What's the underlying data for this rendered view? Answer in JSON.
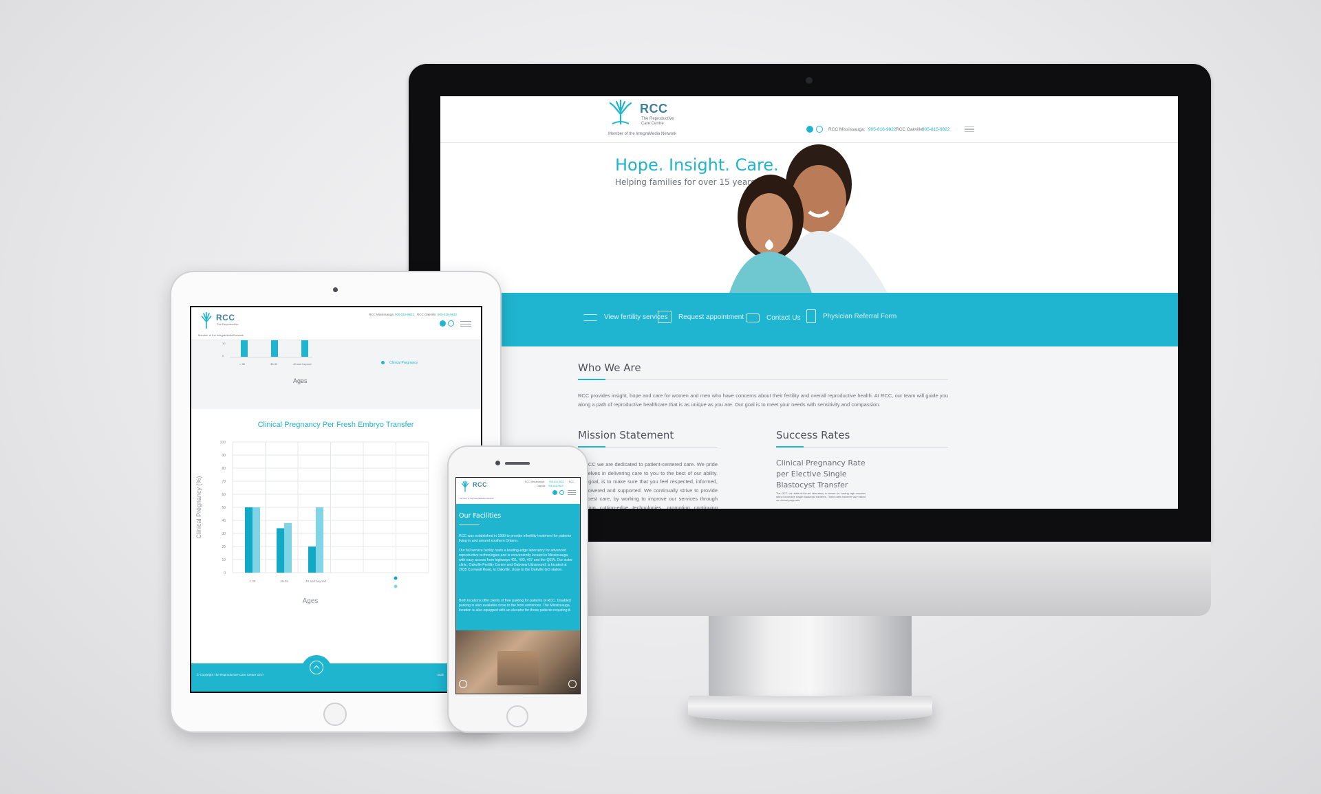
{
  "brand": {
    "logo_text": "RCC",
    "logo_sub_1": "The Reproductive",
    "logo_sub_2": "Care Centre",
    "network": "Member of the IntegraMedia Network",
    "accent": "#1fb5cf",
    "brand_dark": "#3f7fa0"
  },
  "desktop": {
    "contact": {
      "mississauga_label": "RCC Mississauga:",
      "mississauga_phone": "905-816-9822",
      "oakville_label": "RCC Oakville:",
      "oakville_phone": "905-815-9822"
    },
    "social": [
      "facebook-icon",
      "instagram-icon"
    ],
    "hero": {
      "title": "Hope. Insight. Care.",
      "subtitle": "Helping families for over 15 years."
    },
    "nav": [
      {
        "label": "View fertility services",
        "icon": "list-icon"
      },
      {
        "label": "Request appointment",
        "icon": "calendar-icon"
      },
      {
        "label": "Contact Us",
        "icon": "chat-icon"
      },
      {
        "label": "Physician Referral Form",
        "icon": "document-icon"
      }
    ],
    "who_we_are": {
      "title": "Who We Are",
      "body": "RCC provides insight, hope and care for women and men who have concerns about their fertility and overall reproductive health. At RCC, our team will guide you along a path of reproductive healthcare that is as unique as you are. Our goal is to meet your needs with sensitivity and compassion."
    },
    "mission": {
      "title": "Mission Statement",
      "body": "At RCC we are dedicated to patient-centered care. We pride ourselves in delivering care to you to the best of our ability. Our goal, is to make sure that you feel respected, informed, empowered and supported. We continually strive to provide the best care, by working to improve our services through seeking cutting-edge technologies, promoting continuing education and self-assessment."
    },
    "success": {
      "title": "Success Rates",
      "line1": "Clinical Pregnancy Rate",
      "line2": "per Elective Single",
      "line3": "Blastocyst Transfer",
      "note": "The RCC our state-of-the-art laboratory is known for having high success rates for elective single blastocyst transfers. These rates however vary based on clinical prognosis."
    }
  },
  "tablet": {
    "contact": {
      "mississauga_label": "RCC Mississauga:",
      "mississauga_phone": "905-816-9822",
      "oakville_label": "RCC Oakville:",
      "oakville_phone": "905-815-9822"
    },
    "top_chart": {
      "categories": [
        "< 35",
        "35-39",
        "40 and beyond"
      ],
      "y_ticks": [
        "10",
        "0"
      ],
      "legend": "Clinical Pregnancy",
      "xlabel": "Ages"
    },
    "footer": {
      "copyright": "© Copyright The Reproductive Care Centre 2017",
      "build": "Built"
    }
  },
  "chart_data": {
    "type": "bar",
    "title": "Clinical Pregnancy Per Fresh Embryo Transfer",
    "xlabel": "Ages",
    "ylabel": "Clinical Pregnancy (%)",
    "categories": [
      "< 35",
      "35-39",
      "40 and beyond"
    ],
    "series": [
      {
        "values": [
          50,
          34,
          20
        ],
        "color": "#12a9c6"
      },
      {
        "values": [
          50,
          38,
          50
        ],
        "color": "#7fd5e6"
      }
    ],
    "y_ticks": [
      "100",
      "90",
      "80",
      "70",
      "60",
      "50",
      "40",
      "30",
      "20",
      "10",
      "0"
    ],
    "ylim": [
      0,
      100
    ],
    "grid": true
  },
  "phone": {
    "contact": {
      "mississauga_label": "RCC Mississauga:",
      "mississauga_phone": "905-816-9822",
      "oakville_label": "RCC",
      "oakville_label_2": "Oakville:",
      "oakville_phone": "905-815-9822"
    },
    "section_title": "Our Facilities",
    "p1": "RCC was established in 1999 to provide infertility treatment for patients living in and around southern Ontario.",
    "p2": "Our full service facility hosts a leading-edge laboratory for advanced reproductive technologies and is conveniently located in Mississauga with easy access from highways 401, 403, 407 and the QEW. Our sister clinic, Oakville Fertility Centre and Oakview Ultrasound, is located at 2035 Cornwall Road, in Oakville, close to the Oakville GO station.",
    "p3": "Both locations offer plenty of free parking for patients of RCC. Disabled parking is also available close to the front entrances. The Mississauga location is also equipped with an elevator for those patients requiring it."
  }
}
